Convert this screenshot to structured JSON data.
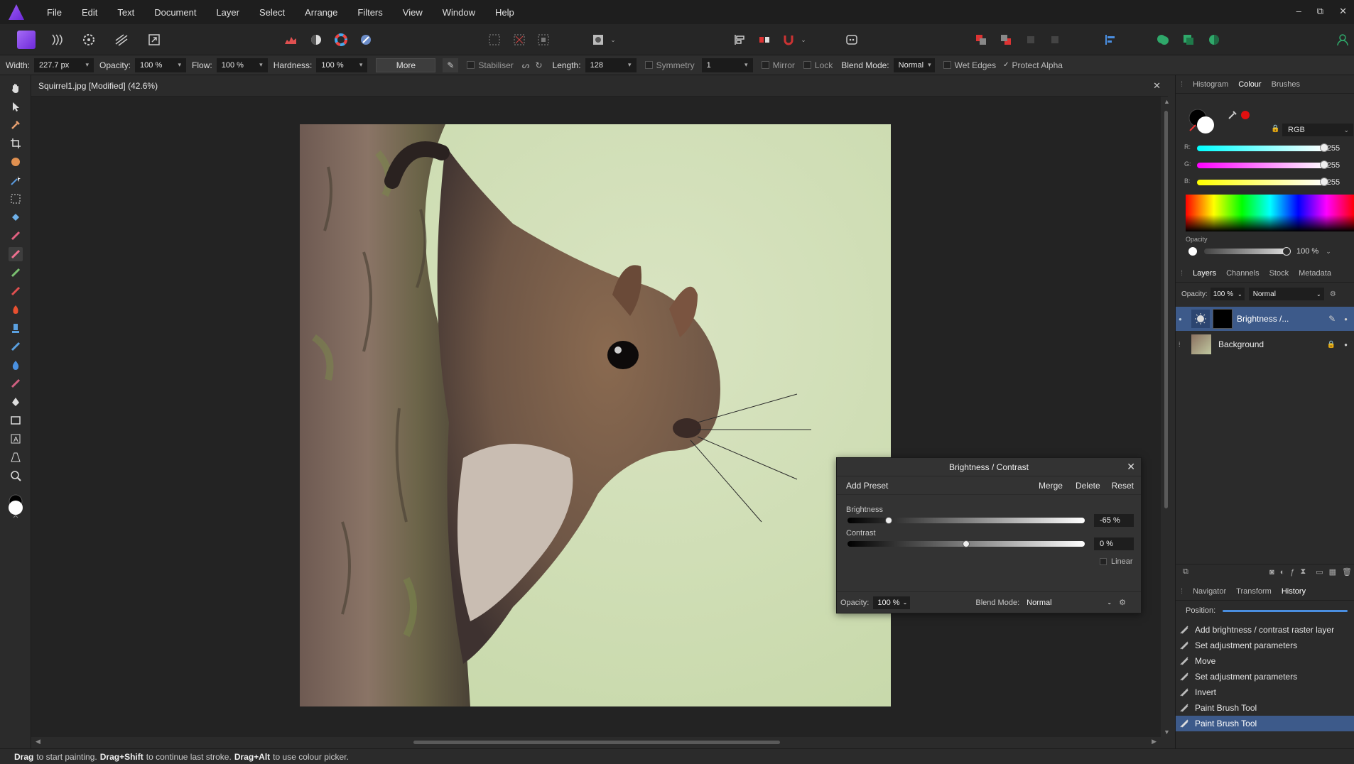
{
  "menubar": {
    "items": [
      "File",
      "Edit",
      "Text",
      "Document",
      "Layer",
      "Select",
      "Arrange",
      "Filters",
      "View",
      "Window",
      "Help"
    ],
    "win_min": "–",
    "win_max": "⧉",
    "win_close": "✕"
  },
  "context": {
    "width_label": "Width:",
    "width_value": "227.7 px",
    "opacity_label": "Opacity:",
    "opacity_value": "100 %",
    "flow_label": "Flow:",
    "flow_value": "100 %",
    "hardness_label": "Hardness:",
    "hardness_value": "100 %",
    "more_label": "More",
    "stabiliser_label": "Stabiliser",
    "length_label": "Length:",
    "length_value": "128",
    "symmetry_label": "Symmetry",
    "symmetry_value": "1",
    "mirror_label": "Mirror",
    "lock_label": "Lock",
    "blend_label": "Blend Mode:",
    "blend_value": "Normal",
    "wet_edges_label": "Wet Edges",
    "protect_alpha_label": "Protect Alpha"
  },
  "document": {
    "tab_title": "Squirrel1.jpg [Modified] (42.6%)"
  },
  "colour_panel": {
    "tabs": [
      "Histogram",
      "Colour",
      "Brushes"
    ],
    "active_tab": "Colour",
    "model": "RGB",
    "r_label": "R:",
    "r_value": "255",
    "g_label": "G:",
    "g_value": "255",
    "b_label": "B:",
    "b_value": "255",
    "opacity_label": "Opacity",
    "opacity_value": "100 %"
  },
  "layers_panel": {
    "tabs": [
      "Layers",
      "Channels",
      "Stock",
      "Metadata"
    ],
    "active_tab": "Layers",
    "opacity_label": "Opacity:",
    "opacity_value": "100 %",
    "blend_value": "Normal",
    "layers": [
      {
        "name": "Brightness /...",
        "selected": true
      },
      {
        "name": "Background",
        "selected": false
      }
    ]
  },
  "history_panel": {
    "tabs": [
      "Navigator",
      "Transform",
      "History"
    ],
    "active_tab": "History",
    "position_label": "Position:",
    "position_value": 1.0,
    "items": [
      "Add brightness / contrast raster layer",
      "Set adjustment parameters",
      "Move",
      "Set adjustment parameters",
      "Invert",
      "Paint Brush Tool",
      "Paint Brush Tool"
    ],
    "selected_index": 6
  },
  "dialog": {
    "title": "Brightness / Contrast",
    "add_preset": "Add Preset",
    "merge": "Merge",
    "delete": "Delete",
    "reset": "Reset",
    "brightness_label": "Brightness",
    "brightness_value": "-65 %",
    "brightness_level": -0.65,
    "contrast_label": "Contrast",
    "contrast_value": "0 %",
    "contrast_level": 0.0,
    "linear_label": "Linear",
    "opacity_label": "Opacity:",
    "opacity_value": "100 %",
    "blend_label": "Blend Mode:",
    "blend_value": "Normal"
  },
  "status": {
    "k1": "Drag",
    "t1": "to start painting.",
    "k2": "Drag+Shift",
    "t2": "to continue last stroke.",
    "k3": "Drag+Alt",
    "t3": "to use colour picker."
  },
  "colors": {
    "accent": "#9b5cf6",
    "selection": "#3d5a8a",
    "panel_bg": "#2b2b2b"
  }
}
